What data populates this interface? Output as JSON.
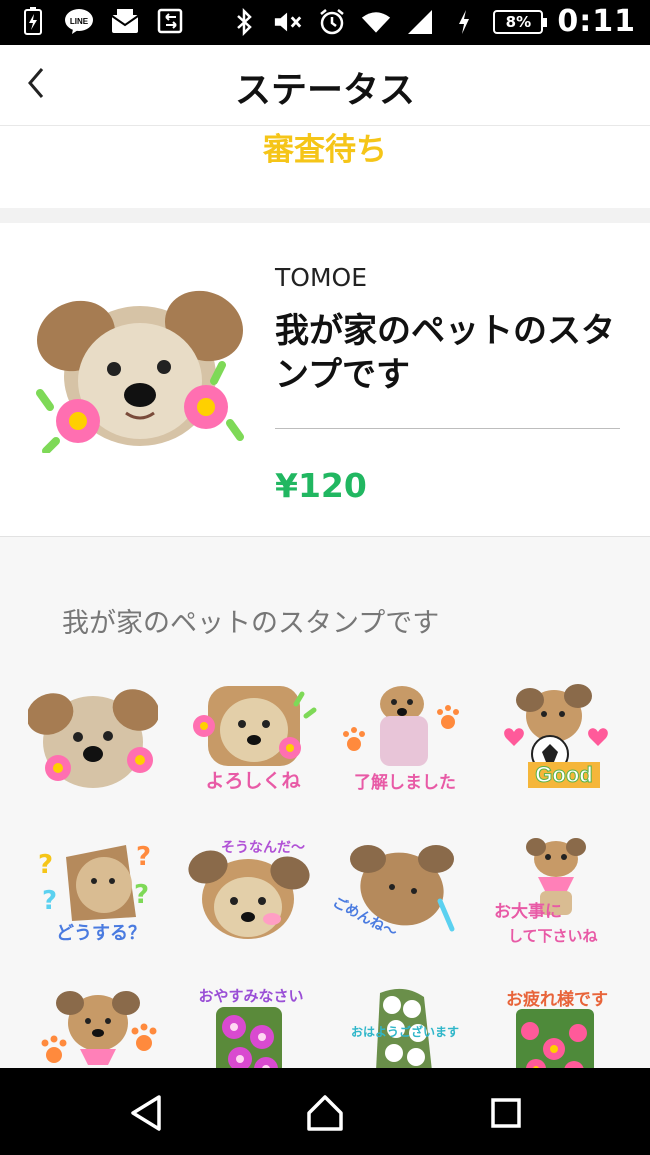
{
  "status_bar": {
    "battery_percent": "8%",
    "time": "0:11",
    "line_label": "LINE"
  },
  "header": {
    "title": "ステータス"
  },
  "review": {
    "status": "審査待ち"
  },
  "package": {
    "author": "TOMOE",
    "title": "我が家のペットのスタンプです",
    "price": "¥120"
  },
  "description": "我が家のペットのスタンプです",
  "stickers": [
    {
      "caption": ""
    },
    {
      "caption": "よろしくね"
    },
    {
      "caption": "了解しました"
    },
    {
      "caption": "Good"
    },
    {
      "caption": "どうする？"
    },
    {
      "caption": "そうなんだ～"
    },
    {
      "caption": "ごめんね～"
    },
    {
      "caption": "お大事に",
      "caption2": "して下さいね"
    },
    {
      "caption": ""
    },
    {
      "caption": "おやすみなさい"
    },
    {
      "caption": "おはようございます"
    },
    {
      "caption": "お疲れ様です"
    }
  ],
  "colors": {
    "review_yellow": "#f5c518",
    "price_green": "#21b761",
    "status_bar": "#000000"
  }
}
